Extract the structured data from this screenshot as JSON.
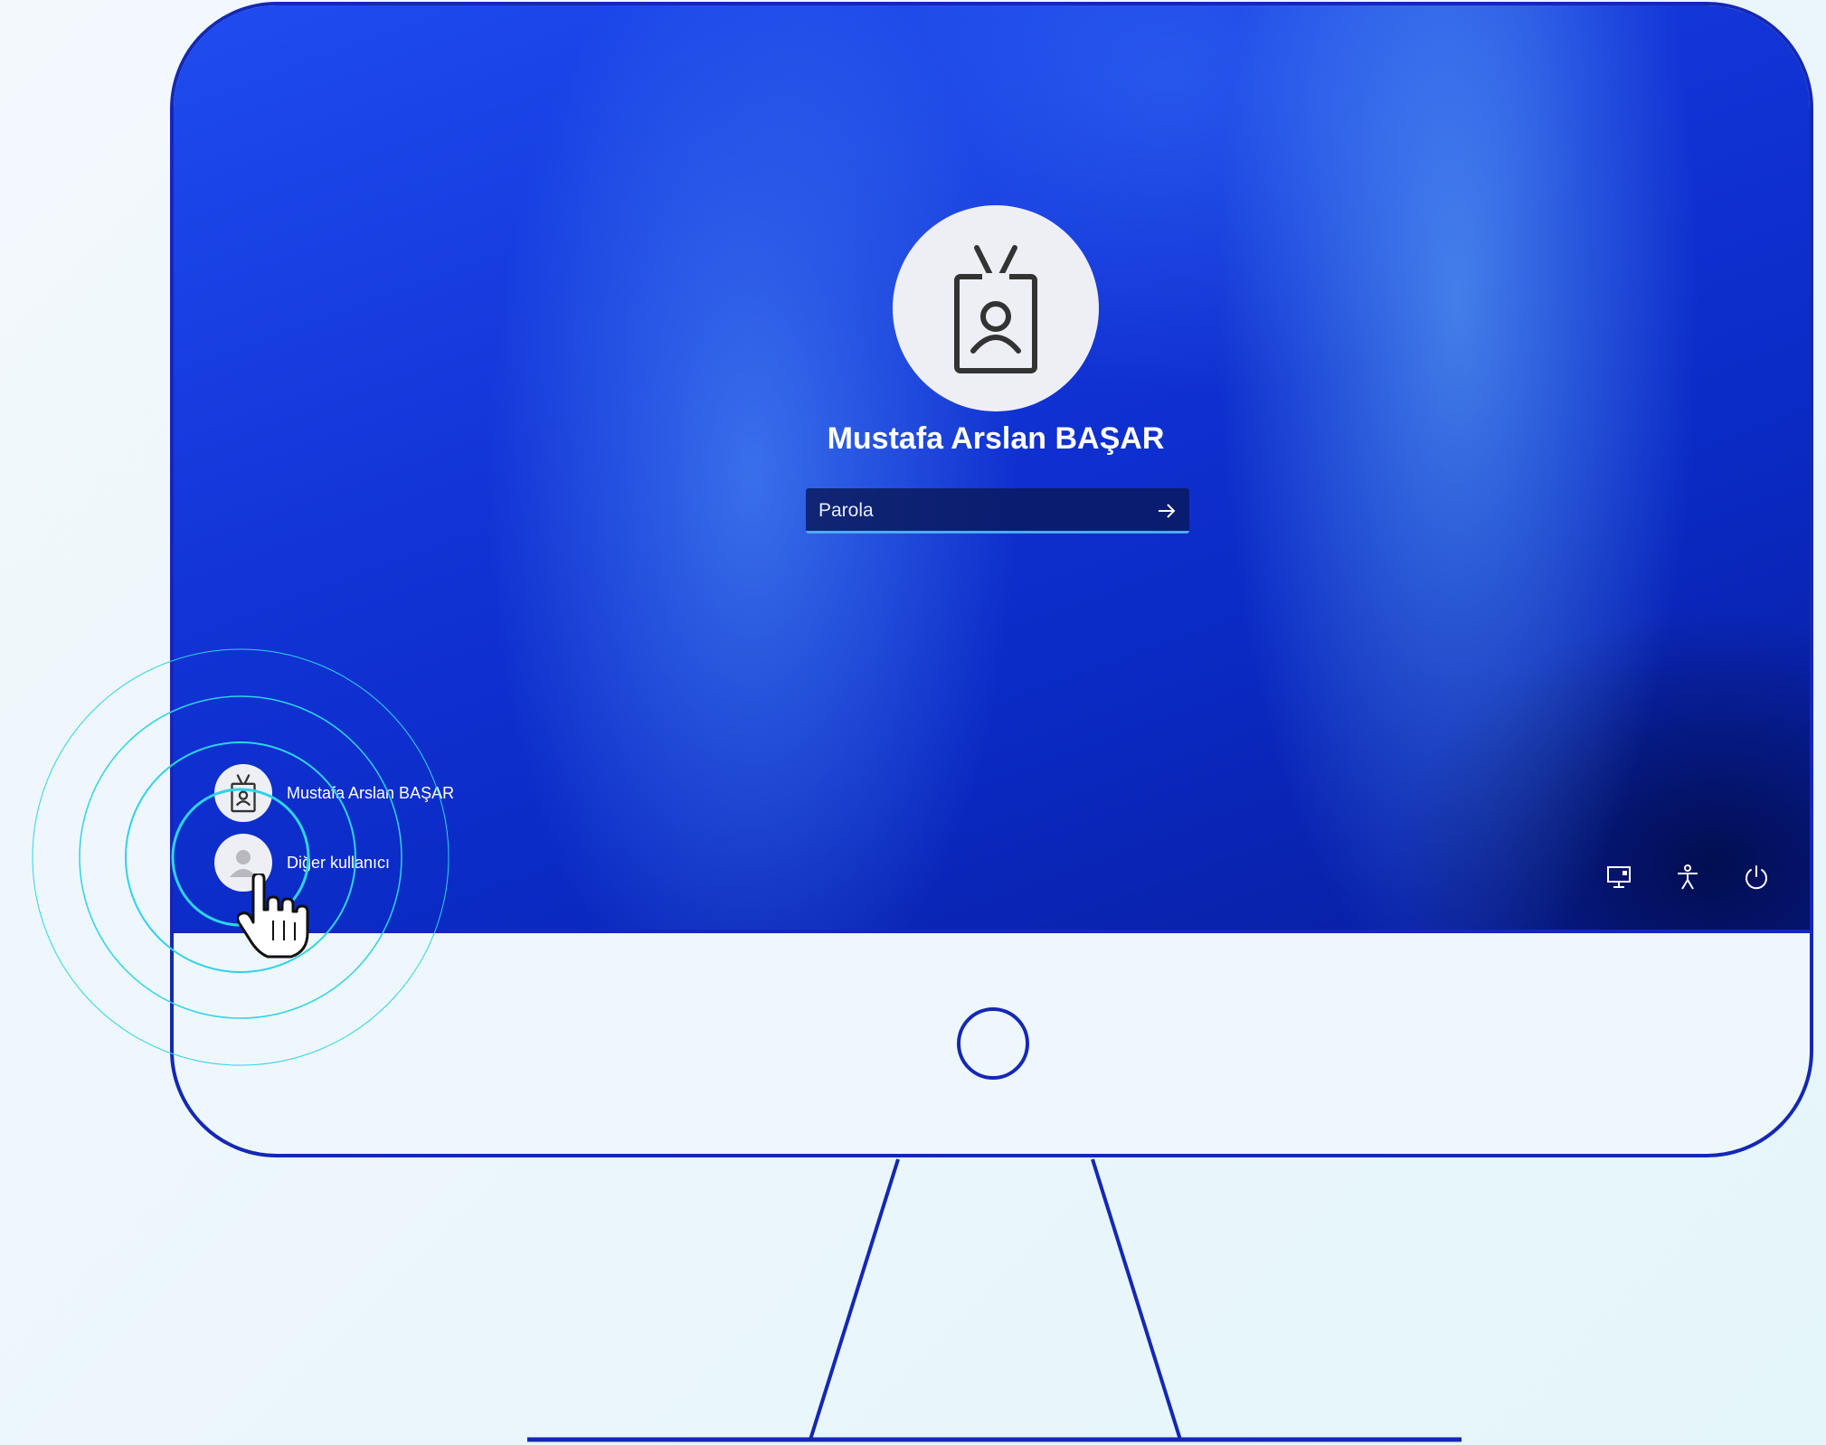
{
  "login": {
    "user_name": "Mustafa Arslan BAŞAR",
    "password_placeholder": "Parola",
    "submit_icon": "arrow-right-icon",
    "avatar_icon": "id-badge-icon"
  },
  "user_list": [
    {
      "label": "Mustafa Arslan BAŞAR",
      "icon": "id-badge-icon"
    },
    {
      "label": "Diğer kullanıcı",
      "icon": "person-icon"
    }
  ],
  "system_icons": [
    "network-icon",
    "accessibility-icon",
    "power-icon"
  ],
  "colors": {
    "frame": "#1428b4",
    "screen": "#1234d6",
    "ripple": "#2fd3e6",
    "input_underline": "#4fa8ff"
  }
}
